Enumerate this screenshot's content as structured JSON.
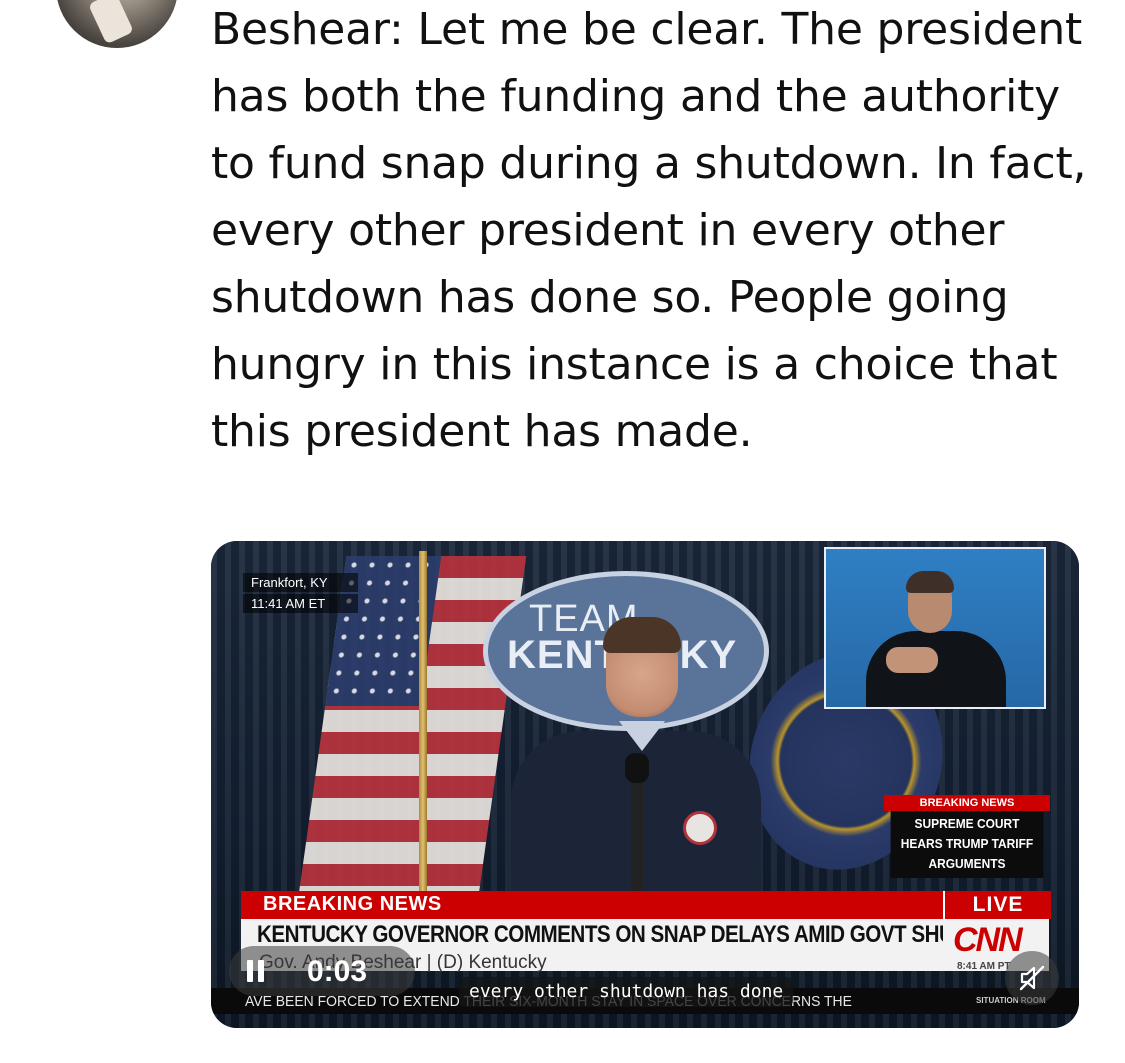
{
  "post": {
    "text": "Beshear: Let me be clear. The president has both the funding and the authority to fund snap during a shutdown. In fact, every other president in every other shutdown has done so. People going hungry in this instance is a choice that this president has made."
  },
  "video": {
    "location_line1": "Frankfort, KY",
    "location_line2": "11:41 AM ET",
    "backdrop_text_line1": "TEAM",
    "backdrop_text_line2": "KENTUCKY",
    "side_banner": {
      "tag": "BREAKING NEWS",
      "text": "SUPREME COURT HEARS TRUMP TARIFF ARGUMENTS"
    },
    "lower_third": {
      "label": "BREAKING NEWS",
      "live": "LIVE",
      "headline": "KENTUCKY GOVERNOR COMMENTS ON SNAP DELAYS AMID GOVT SHUTDOWN",
      "subline": "Gov. Andy Beshear  |  (D) Kentucky",
      "network": "CNN",
      "time": "8:41 AM PT"
    },
    "ticker": {
      "text": "AVE BEEN FORCED TO EXTEND THEIR SIX-MONTH STAY IN SPACE OVER CONCERNS THE",
      "tag": "SITUATION ROOM"
    },
    "playback_time": "0:03",
    "caption": "every other shutdown has done",
    "colors": {
      "cnn_red": "#cc0000",
      "interpreter_bg": "#2f7fc4"
    },
    "icons": {
      "pause": "pause-icon",
      "mute": "speaker-muted-icon"
    }
  }
}
